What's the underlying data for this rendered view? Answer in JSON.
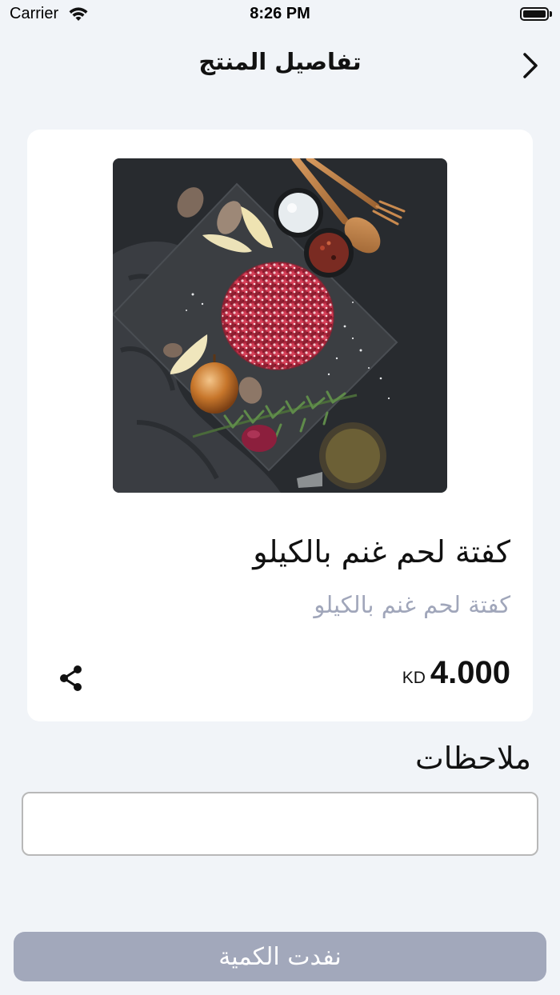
{
  "status_bar": {
    "carrier": "Carrier",
    "time": "8:26 PM",
    "icons": [
      "wifi-icon",
      "battery-icon"
    ]
  },
  "nav": {
    "title": "تفاصيل المنتج",
    "back_icon": "chevron-right-icon"
  },
  "product": {
    "name": "كفتة لحم غنم بالكيلو",
    "subtitle": "كفتة لحم غنم بالكيلو",
    "currency": "KD",
    "price": "4.000",
    "share_icon": "share-icon"
  },
  "notes": {
    "label": "ملاحظات",
    "value": "",
    "placeholder": ""
  },
  "action": {
    "label": "نفدت الكمية"
  },
  "colors": {
    "background": "#f1f4f8",
    "card": "#ffffff",
    "subtitle": "#a0a6ba",
    "button_disabled": "#a2a8bb"
  }
}
